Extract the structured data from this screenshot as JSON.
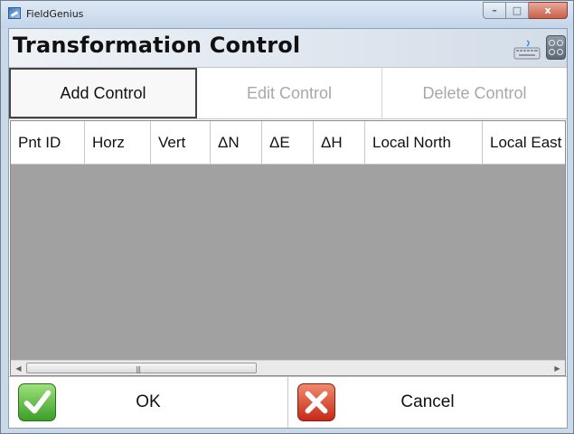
{
  "window": {
    "title": "FieldGenius",
    "controls": {
      "minimize": "–",
      "maximize": "□",
      "close": "x"
    }
  },
  "header": {
    "title": "Transformation Control",
    "icons": [
      "keyboard-icon",
      "settings-icon"
    ]
  },
  "toolbar": {
    "buttons": [
      {
        "label": "Add Control",
        "state": "active"
      },
      {
        "label": "Edit Control",
        "state": "disabled"
      },
      {
        "label": "Delete Control",
        "state": "disabled"
      }
    ]
  },
  "table": {
    "columns": [
      "Pnt ID",
      "Horz",
      "Vert",
      "ΔN",
      "ΔE",
      "ΔH",
      "Local North",
      "Local East"
    ],
    "rows": []
  },
  "scrollbar": {
    "left_arrow": "◀",
    "right_arrow": "▶",
    "grip": "|||"
  },
  "footer": {
    "ok_label": "OK",
    "cancel_label": "Cancel"
  },
  "colors": {
    "table_background": "#a1a1a1",
    "ok_green": "#3b9e27",
    "cancel_red": "#c62a16"
  }
}
